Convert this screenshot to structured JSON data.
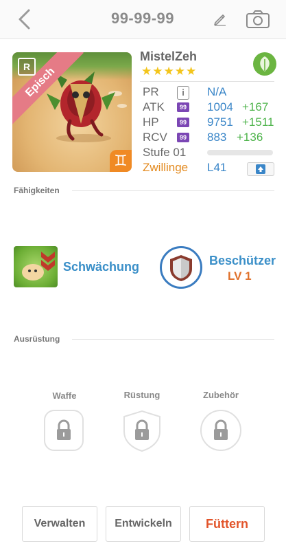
{
  "header": {
    "title": "99-99-99"
  },
  "monster": {
    "name": "MistelZeh",
    "rarity_label": "Episch",
    "rarity_badge": "R",
    "stars": "★★★★★",
    "sign_glyph": "♊",
    "element": "leaf"
  },
  "stats": {
    "pr": {
      "label": "PR",
      "value": "N/A"
    },
    "atk": {
      "label": "ATK",
      "badge": "99",
      "value": "1004",
      "bonus": "+167"
    },
    "hp": {
      "label": "HP",
      "badge": "99",
      "value": "9751",
      "bonus": "+1511"
    },
    "rcv": {
      "label": "RCV",
      "badge": "99",
      "value": "883",
      "bonus": "+136"
    },
    "level": {
      "label": "Stufe 01",
      "progress": 0
    },
    "sign": {
      "label": "Zwillinge",
      "value": "L41"
    }
  },
  "abilities": {
    "section_title": "Fähigkeiten",
    "skill": {
      "name": "Schwächung"
    },
    "leader": {
      "name": "Beschützer",
      "level": "LV 1"
    }
  },
  "equipment": {
    "section_title": "Ausrüstung",
    "slots": [
      {
        "label": "Waffe"
      },
      {
        "label": "Rüstung"
      },
      {
        "label": "Zubehör"
      }
    ]
  },
  "actions": {
    "manage": "Verwalten",
    "evolve": "Entwickeln",
    "feed": "Füttern"
  },
  "colors": {
    "accent_blue": "#3a8fc8",
    "bonus_green": "#4db34a",
    "feed_orange": "#e2542a",
    "star_yellow": "#f3c51c",
    "rarity_pink": "#e57b86"
  }
}
